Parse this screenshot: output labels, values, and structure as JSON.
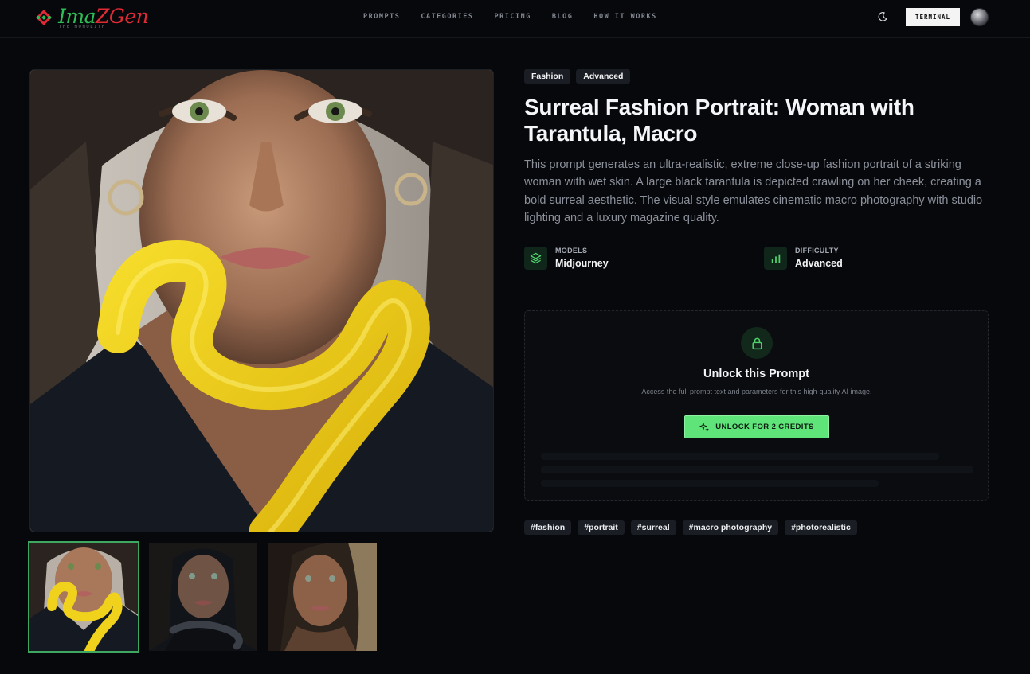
{
  "brand": {
    "name_part1": "Ima",
    "name_part2": "Z",
    "name_part3": "Gen",
    "tagline": "THE MONOLITH"
  },
  "nav": {
    "items": [
      {
        "label": "PROMPTS"
      },
      {
        "label": "CATEGORIES"
      },
      {
        "label": "PRICING"
      },
      {
        "label": "BLOG"
      },
      {
        "label": "HOW IT WORKS"
      }
    ]
  },
  "header": {
    "theme_toggle_icon": "moon-icon",
    "terminal_label": "TERMINAL"
  },
  "prompt": {
    "badges": [
      "Fashion",
      "Advanced"
    ],
    "title": "Surreal Fashion Portrait: Woman with Tarantula, Macro",
    "description": "This prompt generates an ultra-realistic, extreme close-up fashion portrait of a striking woman with wet skin. A large black tarantula is depicted crawling on her cheek, creating a bold surreal aesthetic. The visual style emulates cinematic macro photography with studio lighting and a luxury magazine quality.",
    "models_label": "MODELS",
    "models_value": "Midjourney",
    "difficulty_label": "DIFFICULTY",
    "difficulty_value": "Advanced"
  },
  "unlock": {
    "title": "Unlock this Prompt",
    "text": "Access the full prompt text and parameters for this high-quality AI image.",
    "button_label": "UNLOCK FOR 2 CREDITS"
  },
  "tags": [
    "#fashion",
    "#portrait",
    "#surreal",
    "#macro photography",
    "#photorealistic"
  ],
  "gallery": {
    "thumbnail_count": 3,
    "active_index": 0
  },
  "colors": {
    "accent_green": "#5fe47a",
    "logo_green": "#2ebd54",
    "logo_red": "#e02a35",
    "background": "#07080b"
  }
}
